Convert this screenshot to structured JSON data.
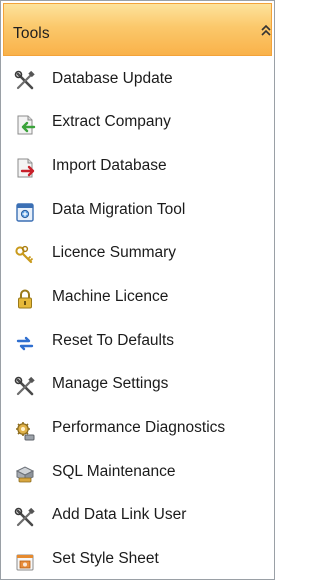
{
  "panel": {
    "title": "Tools",
    "collapse_icon": "double-chevron-up-icon",
    "accent_color": "#f9b24a"
  },
  "items": [
    {
      "label": "Database Update",
      "icon": "crossed-tools-icon"
    },
    {
      "label": "Extract Company",
      "icon": "document-extract-icon"
    },
    {
      "label": "Import Database",
      "icon": "document-import-icon"
    },
    {
      "label": "Data Migration Tool",
      "icon": "data-migration-icon"
    },
    {
      "label": "Licence Summary",
      "icon": "keys-icon"
    },
    {
      "label": "Machine Licence",
      "icon": "padlock-icon"
    },
    {
      "label": "Reset To Defaults",
      "icon": "reset-arrows-icon"
    },
    {
      "label": "Manage Settings",
      "icon": "crossed-tools-icon"
    },
    {
      "label": "Performance Diagnostics",
      "icon": "performance-gear-icon"
    },
    {
      "label": "SQL Maintenance",
      "icon": "sql-server-icon"
    },
    {
      "label": "Add Data Link User",
      "icon": "crossed-tools-icon"
    },
    {
      "label": "Set Style Sheet",
      "icon": "stylesheet-icon"
    }
  ]
}
